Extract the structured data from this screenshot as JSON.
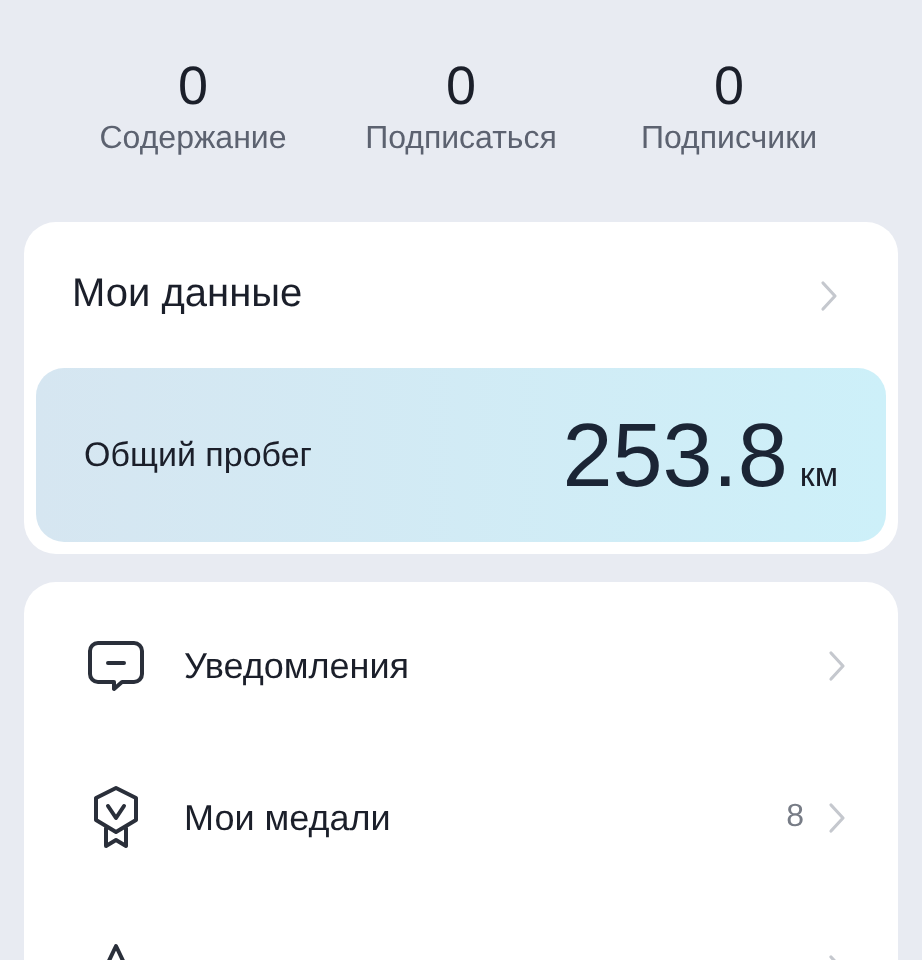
{
  "stats": [
    {
      "value": "0",
      "label": "Содержание"
    },
    {
      "value": "0",
      "label": "Подписаться"
    },
    {
      "value": "0",
      "label": "Подписчики"
    }
  ],
  "my_data": {
    "title": "Мои данные",
    "mileage": {
      "label": "Общий пробег",
      "value": "253.8",
      "unit": "км"
    }
  },
  "menu": [
    {
      "kind": "notifications",
      "label": "Уведомления"
    },
    {
      "kind": "medals",
      "label": "Мои медали",
      "count": "8"
    },
    {
      "kind": "favorites"
    }
  ]
}
